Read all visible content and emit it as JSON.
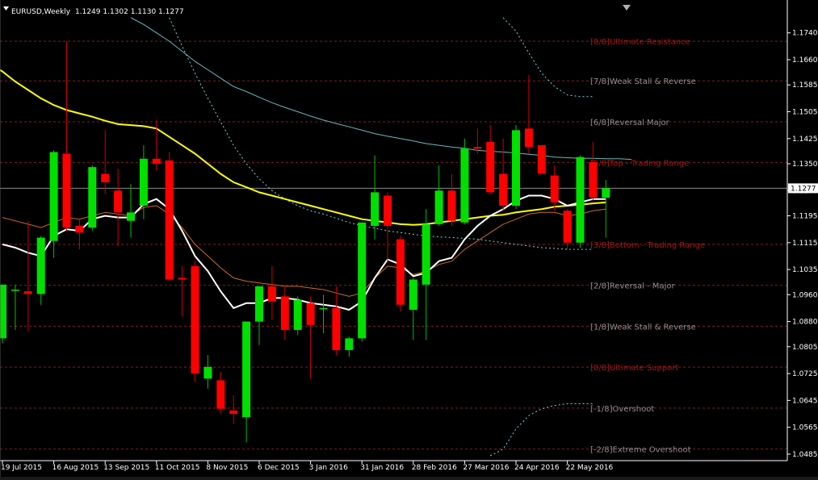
{
  "header": {
    "symbol": "EURUSD,Weekly",
    "ohlc": "1.1249 1.1302 1.1130 1.1277"
  },
  "colors": {
    "background": "#000000",
    "bull": "#00e000",
    "bear": "#ff0000",
    "axis": "#ffffff",
    "murrey_line": "#8a1a1a",
    "ma_yellow": "#ffff00",
    "ma_white": "#ffffff",
    "ma_orange": "#d2691e",
    "ma_teal": "#66bbbb",
    "envelope_cyan": "#66dddd"
  },
  "chart_data": {
    "type": "candlestick",
    "ylim": [
      1.048,
      1.1785
    ],
    "y_ticks": [
      "1.1740",
      "1.1660",
      "1.1585",
      "1.1505",
      "1.1425",
      "1.1350",
      "1.1270",
      "1.1195",
      "1.1115",
      "1.1035",
      "1.0960",
      "1.0880",
      "1.0805",
      "1.0725",
      "1.0645",
      "1.0565",
      "1.0485"
    ],
    "current_price": "1.1277",
    "x_labels": [
      {
        "label": "19 Jul 2015",
        "index": 0
      },
      {
        "label": "16 Aug 2015",
        "index": 4
      },
      {
        "label": "13 Sep 2015",
        "index": 8
      },
      {
        "label": "11 Oct 2015",
        "index": 12
      },
      {
        "label": "8 Nov 2015",
        "index": 16
      },
      {
        "label": "6 Dec 2015",
        "index": 20
      },
      {
        "label": "3 Jan 2016",
        "index": 24
      },
      {
        "label": "31 Jan 2016",
        "index": 28
      },
      {
        "label": "28 Feb 2016",
        "index": 32
      },
      {
        "label": "27 Mar 2016",
        "index": 36
      },
      {
        "label": "24 Apr 2016",
        "index": 40
      },
      {
        "label": "22 May 2016",
        "index": 44
      }
    ],
    "candles": [
      {
        "o": 1.083,
        "h": 1.099,
        "l": 1.0815,
        "c": 1.099
      },
      {
        "o": 1.0975,
        "h": 1.099,
        "l": 1.0855,
        "c": 1.0975
      },
      {
        "o": 1.097,
        "h": 1.118,
        "l": 1.085,
        "c": 1.0962
      },
      {
        "o": 1.0962,
        "h": 1.1135,
        "l": 1.093,
        "c": 1.113
      },
      {
        "o": 1.112,
        "h": 1.139,
        "l": 1.107,
        "c": 1.1385
      },
      {
        "o": 1.138,
        "h": 1.1715,
        "l": 1.115,
        "c": 1.116
      },
      {
        "o": 1.1165,
        "h": 1.1185,
        "l": 1.1095,
        "c": 1.1145
      },
      {
        "o": 1.116,
        "h": 1.1345,
        "l": 1.115,
        "c": 1.134
      },
      {
        "o": 1.132,
        "h": 1.145,
        "l": 1.126,
        "c": 1.1295
      },
      {
        "o": 1.127,
        "h": 1.1335,
        "l": 1.1105,
        "c": 1.1205
      },
      {
        "o": 1.118,
        "h": 1.129,
        "l": 1.113,
        "c": 1.1205
      },
      {
        "o": 1.1225,
        "h": 1.1405,
        "l": 1.1185,
        "c": 1.1365
      },
      {
        "o": 1.1365,
        "h": 1.148,
        "l": 1.133,
        "c": 1.135
      },
      {
        "o": 1.136,
        "h": 1.1385,
        "l": 1.1,
        "c": 1.1005
      },
      {
        "o": 1.101,
        "h": 1.1045,
        "l": 1.0895,
        "c": 1.1005
      },
      {
        "o": 1.1045,
        "h": 1.106,
        "l": 1.07,
        "c": 1.0725
      },
      {
        "o": 1.071,
        "h": 1.078,
        "l": 1.068,
        "c": 1.0745
      },
      {
        "o": 1.0705,
        "h": 1.073,
        "l": 1.0605,
        "c": 1.062
      },
      {
        "o": 1.0615,
        "h": 1.066,
        "l": 1.0575,
        "c": 1.0605
      },
      {
        "o": 1.0595,
        "h": 1.088,
        "l": 1.052,
        "c": 1.088
      },
      {
        "o": 1.088,
        "h": 1.0985,
        "l": 1.081,
        "c": 1.0985
      },
      {
        "o": 1.0985,
        "h": 1.1045,
        "l": 1.0885,
        "c": 1.094
      },
      {
        "o": 1.0955,
        "h": 1.099,
        "l": 1.0825,
        "c": 1.0855
      },
      {
        "o": 1.0855,
        "h": 1.0955,
        "l": 1.084,
        "c": 1.0945
      },
      {
        "o": 1.0935,
        "h": 1.0955,
        "l": 1.071,
        "c": 1.087
      },
      {
        "o": 1.092,
        "h": 1.096,
        "l": 1.0845,
        "c": 1.092
      },
      {
        "o": 1.092,
        "h": 1.0985,
        "l": 1.078,
        "c": 1.0795
      },
      {
        "o": 1.0795,
        "h": 1.0835,
        "l": 1.0775,
        "c": 1.083
      },
      {
        "o": 1.083,
        "h": 1.1175,
        "l": 1.082,
        "c": 1.1175
      },
      {
        "o": 1.1165,
        "h": 1.1375,
        "l": 1.1125,
        "c": 1.1265
      },
      {
        "o": 1.1255,
        "h": 1.1265,
        "l": 1.1055,
        "c": 1.1165
      },
      {
        "o": 1.1125,
        "h": 1.1135,
        "l": 1.091,
        "c": 1.093
      },
      {
        "o": 1.0915,
        "h": 1.101,
        "l": 1.0825,
        "c": 1.1005
      },
      {
        "o": 1.099,
        "h": 1.1215,
        "l": 1.0825,
        "c": 1.117
      },
      {
        "o": 1.117,
        "h": 1.1345,
        "l": 1.1165,
        "c": 1.127
      },
      {
        "o": 1.127,
        "h": 1.132,
        "l": 1.1165,
        "c": 1.118
      },
      {
        "o": 1.1175,
        "h": 1.1425,
        "l": 1.117,
        "c": 1.1395
      },
      {
        "o": 1.14,
        "h": 1.1455,
        "l": 1.138,
        "c": 1.1395
      },
      {
        "o": 1.1415,
        "h": 1.1465,
        "l": 1.126,
        "c": 1.1265
      },
      {
        "o": 1.132,
        "h": 1.1425,
        "l": 1.121,
        "c": 1.1225
      },
      {
        "o": 1.1225,
        "h": 1.1465,
        "l": 1.1215,
        "c": 1.145
      },
      {
        "o": 1.1455,
        "h": 1.1615,
        "l": 1.138,
        "c": 1.14
      },
      {
        "o": 1.1405,
        "h": 1.1405,
        "l": 1.132,
        "c": 1.132
      },
      {
        "o": 1.1315,
        "h": 1.1345,
        "l": 1.121,
        "c": 1.1235
      },
      {
        "o": 1.121,
        "h": 1.1215,
        "l": 1.1095,
        "c": 1.1115
      },
      {
        "o": 1.1115,
        "h": 1.1375,
        "l": 1.11,
        "c": 1.137
      },
      {
        "o": 1.1355,
        "h": 1.1415,
        "l": 1.124,
        "c": 1.125
      },
      {
        "o": 1.1249,
        "h": 1.1302,
        "l": 1.113,
        "c": 1.1277
      }
    ],
    "murrey_levels": [
      {
        "label": "[8/8]Ultimate Resistance",
        "price": 1.1715,
        "color": "#a01a1a"
      },
      {
        "label": "[7/8]Weak Stall & Reverse",
        "price": 1.1597,
        "color": "#909090"
      },
      {
        "label": "[6/8]Reversal Major",
        "price": 1.1475,
        "color": "#909090"
      },
      {
        "label": "[5/8]Top - Trading Range",
        "price": 1.1354,
        "color": "#a01a1a"
      },
      {
        "label": "[3/8]Bottom - Trading Range",
        "price": 1.111,
        "color": "#a01a1a"
      },
      {
        "label": "[2/8]Reversal - Major",
        "price": 1.0988,
        "color": "#909090"
      },
      {
        "label": "[1/8]Weak Stall & Reverse",
        "price": 1.0866,
        "color": "#909090"
      },
      {
        "label": "[0/8]Ultimate Support",
        "price": 1.0744,
        "color": "#a01a1a"
      },
      {
        "label": "[-1/8]Overshoot",
        "price": 1.0622,
        "color": "#909090"
      },
      {
        "label": "[-2/8]Extreme Overshoot",
        "price": 1.05,
        "color": "#909090"
      }
    ],
    "ma_white": [
      [
        0,
        1.111
      ],
      [
        1,
        1.11
      ],
      [
        2,
        1.1085
      ],
      [
        3,
        1.1075
      ],
      [
        4,
        1.1135
      ],
      [
        5,
        1.1155
      ],
      [
        6,
        1.115
      ],
      [
        7,
        1.1185
      ],
      [
        8,
        1.1195
      ],
      [
        9,
        1.119
      ],
      [
        10,
        1.119
      ],
      [
        11,
        1.123
      ],
      [
        12,
        1.1245
      ],
      [
        13,
        1.1215
      ],
      [
        14,
        1.115
      ],
      [
        15,
        1.1075
      ],
      [
        16,
        1.103
      ],
      [
        17,
        1.097
      ],
      [
        18,
        1.092
      ],
      [
        19,
        1.0935
      ],
      [
        20,
        1.0935
      ],
      [
        21,
        1.095
      ],
      [
        22,
        1.095
      ],
      [
        23,
        1.0945
      ],
      [
        24,
        1.0935
      ],
      [
        25,
        1.093
      ],
      [
        26,
        1.0925
      ],
      [
        27,
        1.0915
      ],
      [
        28,
        1.094
      ],
      [
        29,
        1.101
      ],
      [
        30,
        1.1065
      ],
      [
        31,
        1.105
      ],
      [
        32,
        1.1015
      ],
      [
        33,
        1.1025
      ],
      [
        34,
        1.106
      ],
      [
        35,
        1.107
      ],
      [
        36,
        1.1125
      ],
      [
        37,
        1.1165
      ],
      [
        38,
        1.1195
      ],
      [
        39,
        1.1215
      ],
      [
        40,
        1.124
      ],
      [
        41,
        1.1255
      ],
      [
        42,
        1.1255
      ],
      [
        43,
        1.1245
      ],
      [
        44,
        1.1225
      ],
      [
        45,
        1.1235
      ],
      [
        46,
        1.1245
      ],
      [
        47,
        1.1245
      ]
    ],
    "ma_orange": [
      [
        0,
        1.119
      ],
      [
        1,
        1.118
      ],
      [
        2,
        1.117
      ],
      [
        3,
        1.116
      ],
      [
        4,
        1.1175
      ],
      [
        5,
        1.119
      ],
      [
        6,
        1.1185
      ],
      [
        7,
        1.1195
      ],
      [
        8,
        1.1205
      ],
      [
        9,
        1.12
      ],
      [
        10,
        1.1195
      ],
      [
        11,
        1.122
      ],
      [
        12,
        1.1225
      ],
      [
        13,
        1.12
      ],
      [
        14,
        1.116
      ],
      [
        15,
        1.111
      ],
      [
        16,
        1.1075
      ],
      [
        17,
        1.104
      ],
      [
        18,
        1.101
      ],
      [
        19,
        1.1
      ],
      [
        20,
        1.0995
      ],
      [
        21,
        1.099
      ],
      [
        22,
        1.0985
      ],
      [
        23,
        1.0985
      ],
      [
        24,
        1.098
      ],
      [
        25,
        1.0975
      ],
      [
        26,
        1.0965
      ],
      [
        27,
        1.0955
      ],
      [
        28,
        1.0965
      ],
      [
        29,
        1.101
      ],
      [
        30,
        1.1045
      ],
      [
        31,
        1.104
      ],
      [
        32,
        1.102
      ],
      [
        33,
        1.103
      ],
      [
        34,
        1.105
      ],
      [
        35,
        1.106
      ],
      [
        36,
        1.1095
      ],
      [
        37,
        1.112
      ],
      [
        38,
        1.1145
      ],
      [
        39,
        1.117
      ],
      [
        40,
        1.1185
      ],
      [
        41,
        1.12
      ],
      [
        42,
        1.1205
      ],
      [
        43,
        1.1205
      ],
      [
        44,
        1.1195
      ],
      [
        45,
        1.12
      ],
      [
        46,
        1.121
      ],
      [
        47,
        1.1215
      ]
    ],
    "ma_yellow": [
      [
        -1,
        1.165
      ],
      [
        0,
        1.1625
      ],
      [
        1,
        1.1595
      ],
      [
        2,
        1.157
      ],
      [
        3,
        1.1545
      ],
      [
        4,
        1.1525
      ],
      [
        5,
        1.151
      ],
      [
        6,
        1.15
      ],
      [
        7,
        1.149
      ],
      [
        8,
        1.1478
      ],
      [
        9,
        1.1468
      ],
      [
        10,
        1.1465
      ],
      [
        11,
        1.1462
      ],
      [
        12,
        1.1455
      ],
      [
        13,
        1.143
      ],
      [
        14,
        1.1405
      ],
      [
        15,
        1.138
      ],
      [
        16,
        1.135
      ],
      [
        17,
        1.132
      ],
      [
        18,
        1.1295
      ],
      [
        19,
        1.128
      ],
      [
        20,
        1.1265
      ],
      [
        21,
        1.1255
      ],
      [
        22,
        1.1245
      ],
      [
        23,
        1.1235
      ],
      [
        24,
        1.1225
      ],
      [
        25,
        1.1215
      ],
      [
        26,
        1.1205
      ],
      [
        27,
        1.1195
      ],
      [
        28,
        1.1185
      ],
      [
        29,
        1.118
      ],
      [
        30,
        1.1175
      ],
      [
        31,
        1.117
      ],
      [
        32,
        1.1168
      ],
      [
        33,
        1.117
      ],
      [
        34,
        1.1175
      ],
      [
        35,
        1.118
      ],
      [
        36,
        1.1185
      ],
      [
        37,
        1.119
      ],
      [
        38,
        1.1195
      ],
      [
        39,
        1.1198
      ],
      [
        40,
        1.1205
      ],
      [
        41,
        1.121
      ],
      [
        42,
        1.1215
      ],
      [
        43,
        1.1222
      ],
      [
        44,
        1.1225
      ],
      [
        45,
        1.1228
      ],
      [
        46,
        1.1232
      ],
      [
        47,
        1.1235
      ]
    ],
    "ma_teal": [
      [
        10,
        1.1785
      ],
      [
        11,
        1.1765
      ],
      [
        12,
        1.174
      ],
      [
        13,
        1.1715
      ],
      [
        14,
        1.1685
      ],
      [
        15,
        1.1655
      ],
      [
        16,
        1.163
      ],
      [
        17,
        1.1605
      ],
      [
        18,
        1.158
      ],
      [
        19,
        1.1565
      ],
      [
        20,
        1.1548
      ],
      [
        21,
        1.1532
      ],
      [
        22,
        1.1518
      ],
      [
        23,
        1.1505
      ],
      [
        24,
        1.1492
      ],
      [
        25,
        1.148
      ],
      [
        26,
        1.147
      ],
      [
        27,
        1.146
      ],
      [
        28,
        1.145
      ],
      [
        29,
        1.144
      ],
      [
        30,
        1.1432
      ],
      [
        31,
        1.1425
      ],
      [
        32,
        1.1418
      ],
      [
        33,
        1.141
      ],
      [
        34,
        1.1405
      ],
      [
        35,
        1.14
      ],
      [
        36,
        1.1396
      ],
      [
        37,
        1.139
      ],
      [
        38,
        1.1387
      ],
      [
        39,
        1.1385
      ],
      [
        40,
        1.1382
      ],
      [
        41,
        1.1378
      ],
      [
        42,
        1.1375
      ],
      [
        43,
        1.137
      ],
      [
        44,
        1.1368
      ],
      [
        45,
        1.1366
      ],
      [
        46,
        1.1366
      ],
      [
        47,
        1.1365
      ],
      [
        48,
        1.1365
      ],
      [
        49,
        1.1363
      ]
    ],
    "envelope_lower": [
      [
        13,
        1.1785
      ],
      [
        14,
        1.17
      ],
      [
        15,
        1.162
      ],
      [
        16,
        1.1545
      ],
      [
        17,
        1.1475
      ],
      [
        18,
        1.1405
      ],
      [
        19,
        1.135
      ],
      [
        20,
        1.1305
      ],
      [
        21,
        1.127
      ],
      [
        22,
        1.1245
      ],
      [
        23,
        1.1225
      ],
      [
        24,
        1.121
      ],
      [
        25,
        1.12
      ],
      [
        26,
        1.1188
      ],
      [
        27,
        1.1175
      ],
      [
        28,
        1.1165
      ],
      [
        29,
        1.1158
      ],
      [
        30,
        1.115
      ],
      [
        31,
        1.1145
      ],
      [
        32,
        1.114
      ],
      [
        33,
        1.1135
      ],
      [
        34,
        1.1132
      ],
      [
        35,
        1.113
      ],
      [
        36,
        1.1128
      ],
      [
        37,
        1.1125
      ],
      [
        38,
        1.112
      ],
      [
        39,
        1.1115
      ],
      [
        40,
        1.111
      ],
      [
        41,
        1.1105
      ],
      [
        42,
        1.11
      ],
      [
        43,
        1.1098
      ],
      [
        44,
        1.1095
      ],
      [
        45,
        1.1095
      ],
      [
        46,
        1.1095
      ]
    ],
    "envelope_upper": [
      [
        39,
        1.1785
      ],
      [
        40,
        1.1745
      ],
      [
        41,
        1.168
      ],
      [
        42,
        1.162
      ],
      [
        43,
        1.158
      ],
      [
        44,
        1.1555
      ],
      [
        45,
        1.155
      ],
      [
        46,
        1.155
      ]
    ],
    "envelope_bottom": [
      [
        38,
        1.048
      ],
      [
        39,
        1.05
      ],
      [
        40,
        1.056
      ],
      [
        41,
        1.06
      ],
      [
        42,
        1.062
      ],
      [
        43,
        1.063
      ],
      [
        44,
        1.0635
      ],
      [
        45,
        1.0635
      ],
      [
        46,
        1.0635
      ]
    ]
  }
}
